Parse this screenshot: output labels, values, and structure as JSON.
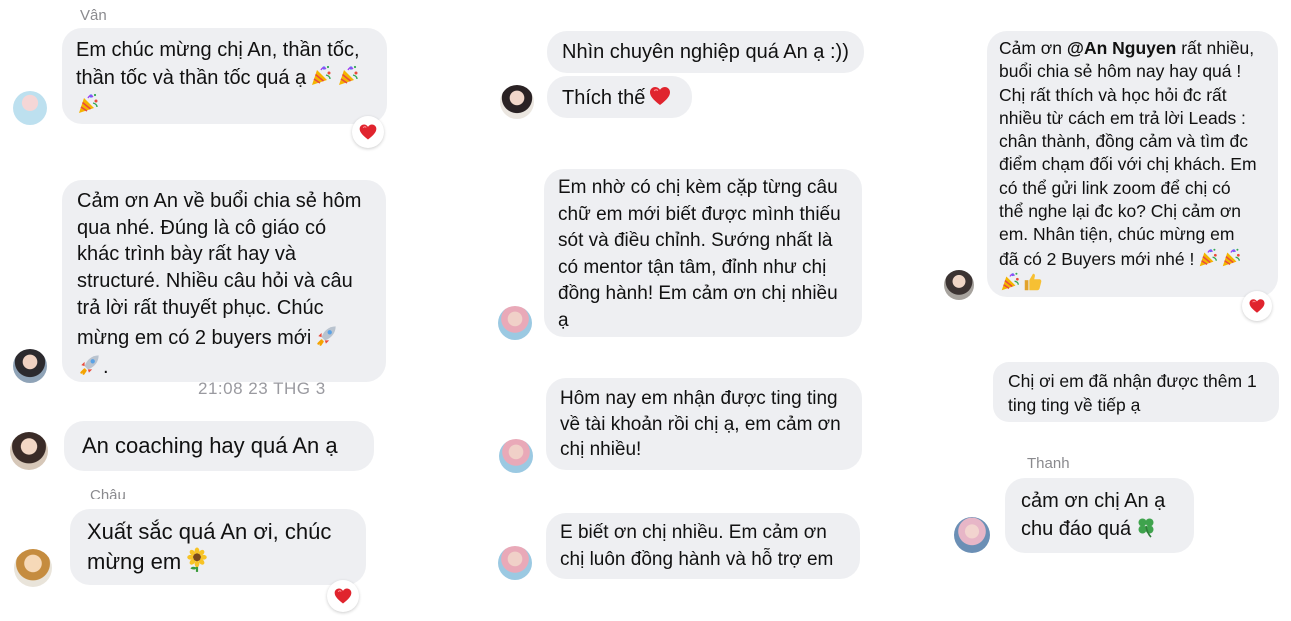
{
  "col1": {
    "sender_van": "Vân",
    "msg_van": "Em chúc mừng chị An, thần tốc,\nthần tốc và thần tốc quá ạ",
    "msg_an": "Cảm ơn An về buổi chia sẻ hôm\nqua nhé. Đúng là cô giáo có\nkhác trình bày rất hay và\nstructuré. Nhiều câu hỏi và câu\ntrả lời rất thuyết phục. Chúc\nmừng em có 2 buyers mới",
    "msg_an_tail": ".",
    "timestamp": "21:08 23 THG 3",
    "msg_coaching": "An coaching hay quá An ạ",
    "sender_chau": "Châu",
    "msg_chau": "Xuất sắc quá An ơi, chúc\nmừng em"
  },
  "col2": {
    "msg_pro": "Nhìn chuyên nghiệp quá An ạ :))",
    "msg_like": "Thích thế",
    "msg_mentor": "Em nhờ có chị kèm cặp từng câu\nchữ em mới biết được mình thiếu\nsót và điều chỉnh. Sướng nhất là\ncó mentor tận tâm, đỉnh như chị\nđồng hành! Em cảm ơn chị nhiều\nạ",
    "msg_ting": "Hôm nay em nhận được ting ting\nvề tài khoản rồi chị ạ, em cảm ơn\nchị nhiều!",
    "msg_thanks": "E biết ơn chị nhiều. Em cảm ơn\nchị luôn đồng hành và hỗ trợ em"
  },
  "col3": {
    "msg_lead_pre": "Cảm ơn ",
    "mention": "@An Nguyen",
    "msg_lead_post": " rất nhiều,\nbuổi chia sẻ hôm nay hay quá !\nChị rất thích và học hỏi đc rất\nnhiều từ cách em trả lời Leads :\nchân thành, đồng cảm và tìm đc\nđiểm chạm đối với chị khách. Em\ncó thể gửi link zoom để chị có\nthể nghe lại đc ko? Chị cảm ơn\nem. Nhân tiện, chúc mừng em\nđã có 2 Buyers mới nhé !",
    "msg_ting2": "Chị ơi em đã nhận được thêm 1\nting ting về tiếp ạ",
    "sender_thanh": "Thanh",
    "msg_thanh": "cảm ơn chị An ạ\nchu đáo quá"
  },
  "colors": {
    "bubble": "#eeeff2",
    "heart": "#e0242e",
    "meta": "#9a9aa0"
  },
  "icons": [
    "party-popper-icon",
    "rocket-icon",
    "heart-icon",
    "sunflower-icon",
    "four-leaf-clover-icon",
    "thumbs-up-icon"
  ]
}
